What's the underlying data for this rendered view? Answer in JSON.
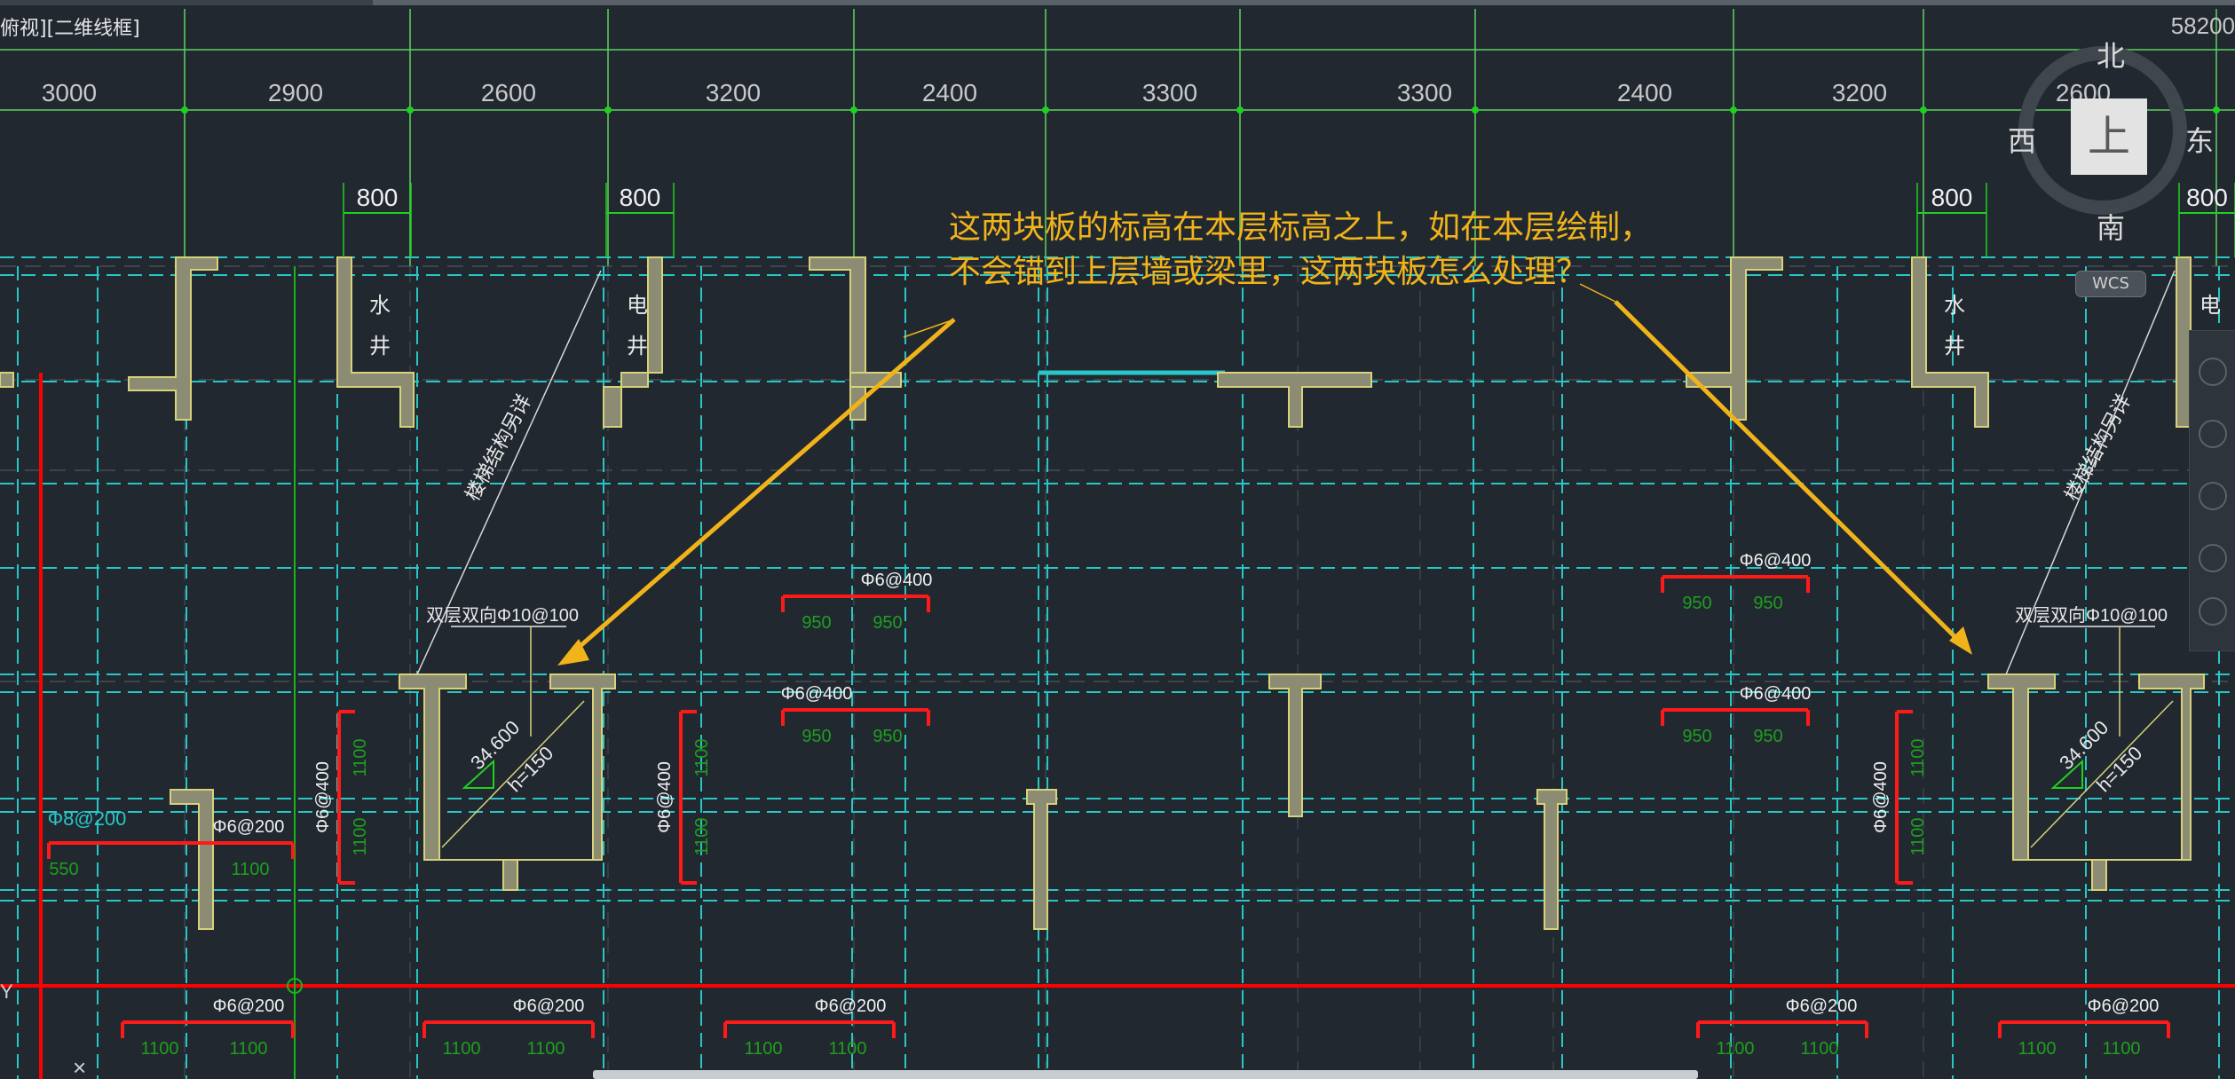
{
  "viewport": {
    "label": "俯视][二维线框]",
    "top_coordinate": "58200"
  },
  "dimensions": {
    "spans": [
      "3000",
      "2900",
      "2600",
      "3200",
      "2400",
      "3300",
      "3300",
      "2400",
      "3200",
      "2600"
    ],
    "openings": [
      "800",
      "800",
      "800",
      "800"
    ]
  },
  "annotation": {
    "line1": "这两块板的标高在本层标高之上，如在本层绘制，",
    "line2": "不会锚到上层墙或梁里，这两块板怎么处理？",
    "color": "#f0b31a"
  },
  "shafts": {
    "water": [
      "水",
      "井"
    ],
    "electric": [
      "电",
      "井"
    ],
    "stair_note": "楼梯结构另详"
  },
  "rebar": {
    "top_bar": "双层双向Φ10@100",
    "slab_elevation": "34.600",
    "slab_thickness": "h=150",
    "tag_6_400": "Φ6@400",
    "tag_6_200": "Φ6@200",
    "tag_8_200": "Φ8@200",
    "len_950": "950",
    "len_1100": "1100",
    "len_550": "550"
  },
  "navcube": {
    "north": "北",
    "south": "南",
    "east": "东",
    "west": "西",
    "top": "上",
    "wcs": "WCS"
  },
  "colors": {
    "background": "#212830",
    "axis_green": "#5fd35f",
    "dim_green": "#1fd11f",
    "wall_fill": "#8c8b73",
    "wall_edge": "#d7d27a",
    "beam_cyan": "#29c6c6",
    "rebar_red": "#ff1a1a",
    "rebar_len_green": "#1f9f1f",
    "axis_red": "#ff0000"
  }
}
